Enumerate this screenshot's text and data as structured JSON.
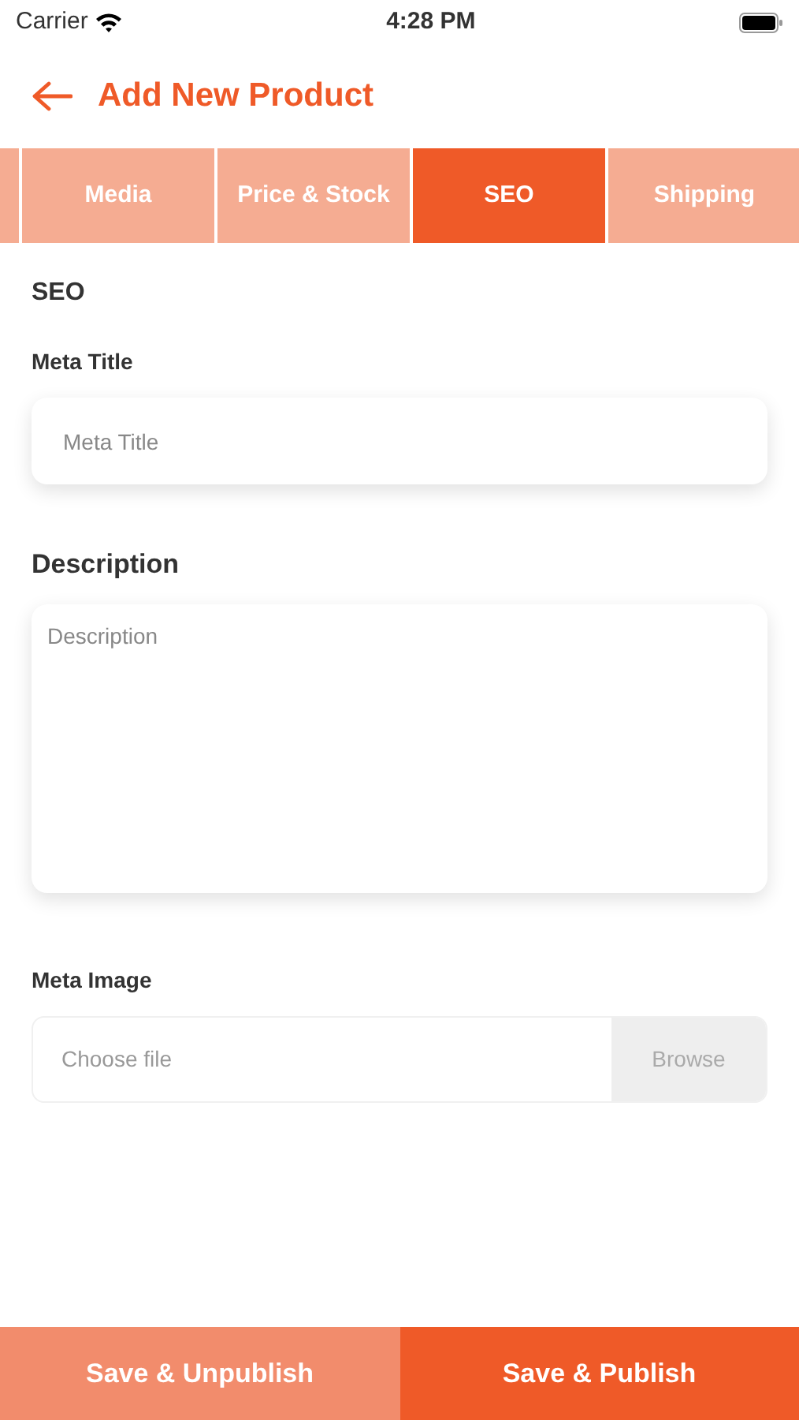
{
  "status_bar": {
    "carrier": "Carrier",
    "time": "4:28 PM"
  },
  "header": {
    "title": "Add New Product"
  },
  "tabs": [
    {
      "label": "Media",
      "selected": false
    },
    {
      "label": "Price & Stock",
      "selected": false
    },
    {
      "label": "SEO",
      "selected": true
    },
    {
      "label": "Shipping",
      "selected": false
    }
  ],
  "section_title": "SEO",
  "fields": [
    {
      "kind": "input",
      "label": "Meta Title",
      "placeholder": "Meta Title"
    },
    {
      "kind": "textarea",
      "label": "Description",
      "placeholder": "Description"
    },
    {
      "kind": "file",
      "label": "Meta Image",
      "placeholder": "Choose file",
      "button": "Browse"
    }
  ],
  "buttons": [
    {
      "label": "Save & Unpublish",
      "kind": "secondary"
    },
    {
      "label": "Save & Publish",
      "kind": "primary"
    }
  ]
}
